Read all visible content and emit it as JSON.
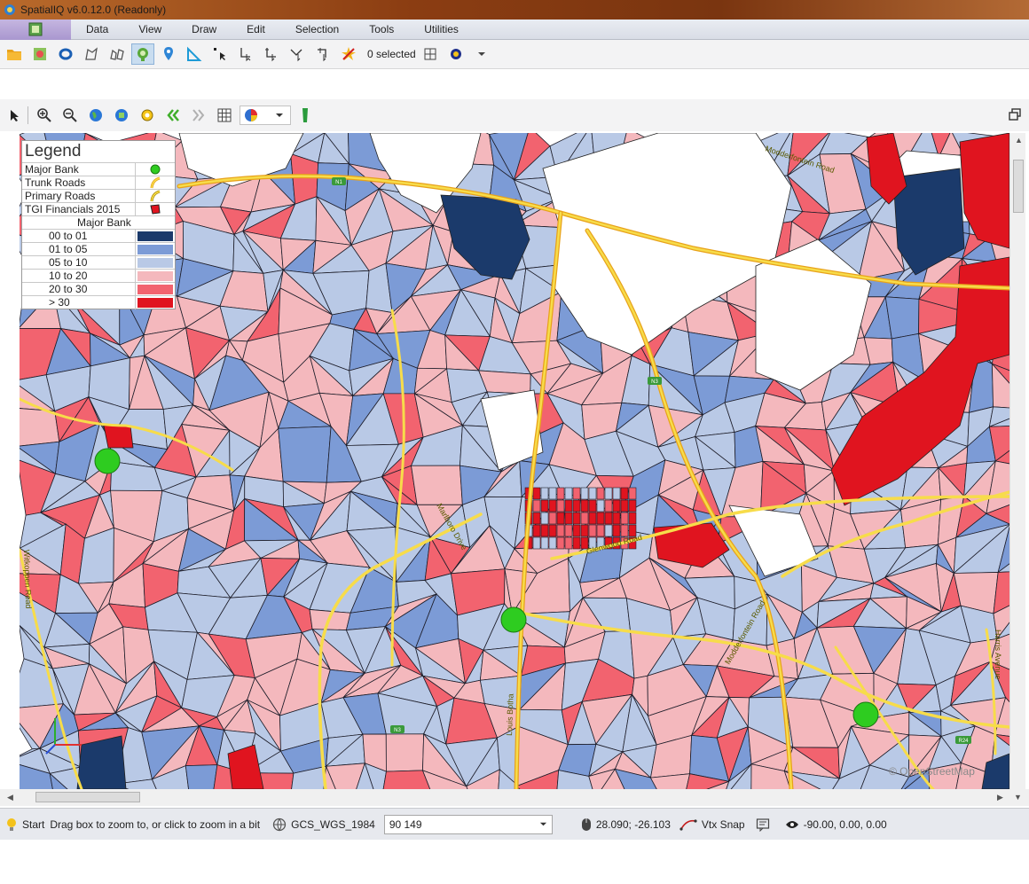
{
  "window": {
    "title": "SpatialIQ v6.0.12.0 (Readonly)"
  },
  "menu": {
    "items": [
      "Data",
      "View",
      "Draw",
      "Edit",
      "Selection",
      "Tools",
      "Utilities"
    ]
  },
  "toolbar1": {
    "selected_count": "0 selected"
  },
  "legend": {
    "title": "Legend",
    "layers": [
      {
        "label": "Major Bank",
        "symbol": "green-circle"
      },
      {
        "label": "Trunk Roads",
        "symbol": "road-line"
      },
      {
        "label": "Primary Roads",
        "symbol": "road-line"
      },
      {
        "label": "TGI Financials 2015",
        "symbol": "polygon"
      }
    ],
    "sublabel": "Major Bank",
    "classes": [
      {
        "label": "00 to 01",
        "color": "#1b3a6b"
      },
      {
        "label": "01 to 05",
        "color": "#7c9bd6"
      },
      {
        "label": "05 to 10",
        "color": "#b9c9e6"
      },
      {
        "label": "10 to 20",
        "color": "#f4b8bd"
      },
      {
        "label": "20 to 30",
        "color": "#f2636f"
      },
      {
        "label": "> 30",
        "color": "#e0141f"
      }
    ]
  },
  "map": {
    "road_labels": [
      "N1",
      "N3",
      "R24",
      "N3"
    ],
    "street_labels": [
      "Modderfontein Road",
      "Modderfontein Road",
      "Glenwood Road",
      "Harris Avenue",
      "Louis Botha",
      "Marlboro Drive",
      "Witkoppen Road"
    ],
    "attribution": "© OpenStreetMap"
  },
  "status": {
    "start_label": "Start",
    "hint": "Drag box to zoom to, or click to zoom in a bit",
    "projection": "GCS_WGS_1984",
    "scale_value": "90 149",
    "coordinates": "28.090; -26.103",
    "vtx_snap": "Vtx Snap",
    "view_angles": "-90.00, 0.00, 0.00"
  },
  "colors": {
    "class_00_01": "#1b3a6b",
    "class_01_05": "#7c9bd6",
    "class_05_10": "#b9c9e6",
    "class_10_20": "#f4b8bd",
    "class_20_30": "#f2636f",
    "class_gt_30": "#e0141f",
    "bank": "#2ecc20",
    "road": "#f7dc4a"
  }
}
